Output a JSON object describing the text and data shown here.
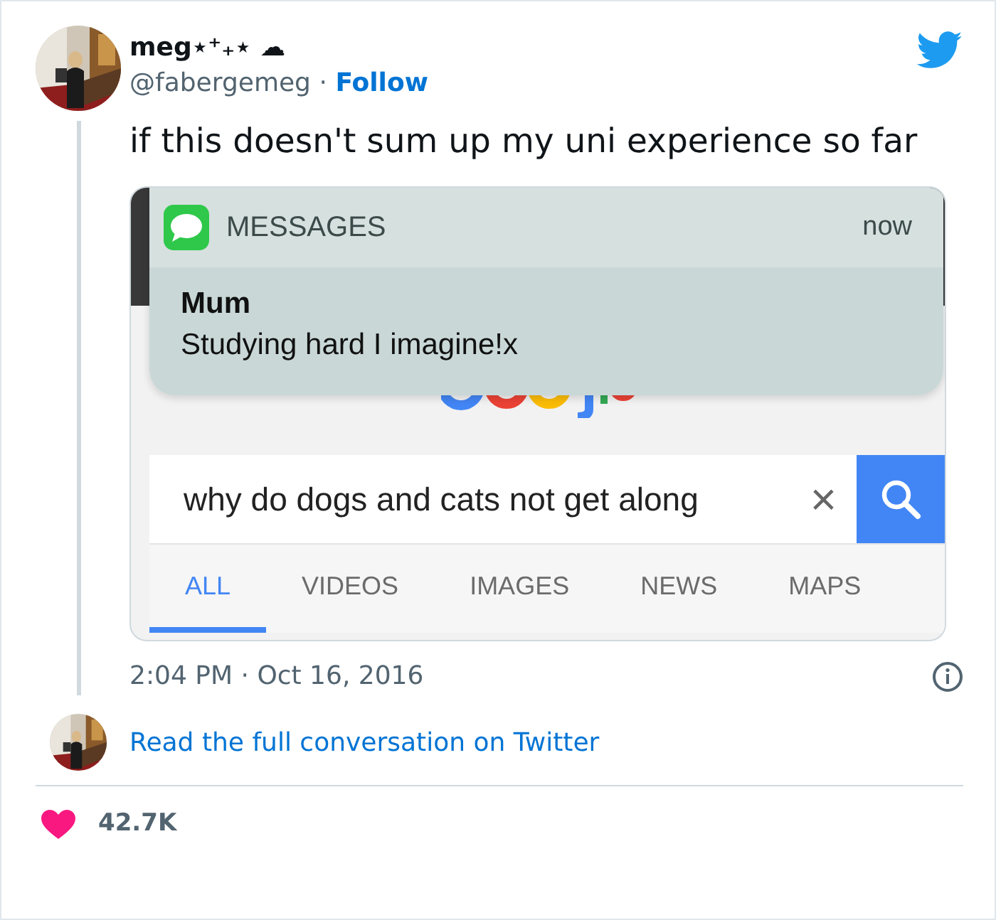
{
  "author": {
    "name": "meg⋆⁺₊⋆ ☁",
    "handle": "@fabergemeg",
    "separator": "·",
    "follow": "Follow"
  },
  "text": "if this doesn't sum up my uni experience so far",
  "media": {
    "notification": {
      "app": "MESSAGES",
      "time": "now",
      "sender": "Mum",
      "message": "Studying hard I imagine!x"
    },
    "search": {
      "value": "why do dogs and cats not get along",
      "clear": "×"
    },
    "tabs": [
      {
        "label": "ALL",
        "selected": true
      },
      {
        "label": "VIDEOS",
        "selected": false
      },
      {
        "label": "IMAGES",
        "selected": false
      },
      {
        "label": "NEWS",
        "selected": false
      },
      {
        "label": "MAPS",
        "selected": false
      }
    ]
  },
  "timestamp": "2:04 PM · Oct 16, 2016",
  "conversation_link": "Read the full conversation on Twitter",
  "likes": {
    "count": "42.7K"
  }
}
